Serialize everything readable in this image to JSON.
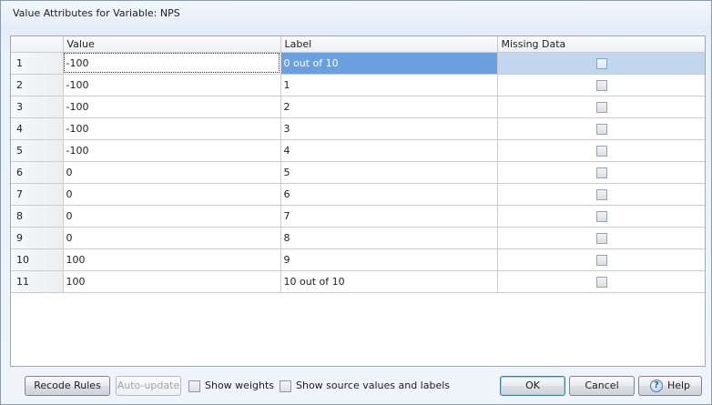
{
  "window": {
    "title": "Value Attributes for Variable: NPS"
  },
  "grid": {
    "columns": [
      "",
      "Value",
      "Label",
      "Missing Data"
    ],
    "rows": [
      {
        "num": "1",
        "value": "-100",
        "label": "0 out of 10",
        "missing": false,
        "selected": true
      },
      {
        "num": "2",
        "value": "-100",
        "label": "1",
        "missing": false
      },
      {
        "num": "3",
        "value": "-100",
        "label": "2",
        "missing": false
      },
      {
        "num": "4",
        "value": "-100",
        "label": "3",
        "missing": false
      },
      {
        "num": "5",
        "value": "-100",
        "label": "4",
        "missing": false
      },
      {
        "num": "6",
        "value": "0",
        "label": "5",
        "missing": false
      },
      {
        "num": "7",
        "value": "0",
        "label": "6",
        "missing": false
      },
      {
        "num": "8",
        "value": "0",
        "label": "7",
        "missing": false
      },
      {
        "num": "9",
        "value": "0",
        "label": "8",
        "missing": false
      },
      {
        "num": "10",
        "value": "100",
        "label": "9",
        "missing": false
      },
      {
        "num": "11",
        "value": "100",
        "label": "10 out of 10",
        "missing": false
      }
    ]
  },
  "footer": {
    "recode_rules": "Recode Rules",
    "auto_update": "Auto-update",
    "show_weights": "Show weights",
    "show_source": "Show source values and labels",
    "ok": "OK",
    "cancel": "Cancel",
    "help": "Help"
  },
  "colors": {
    "selection": "#6ba0e0",
    "selection_light": "#c2d6ee",
    "default_button_border": "#3c7fb1"
  }
}
